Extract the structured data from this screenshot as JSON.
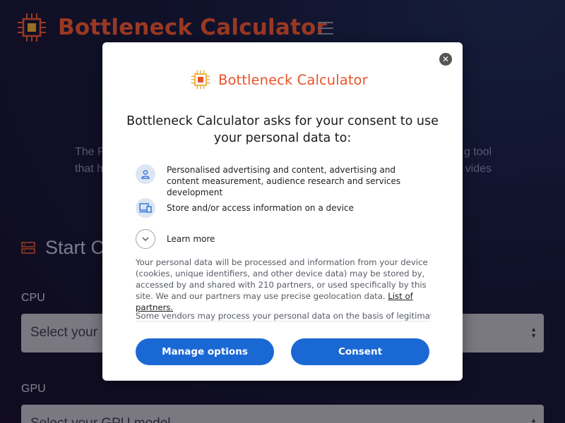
{
  "site": {
    "title": "Bottleneck Calculator",
    "accent_color": "#e8542a",
    "menu_icon": "hamburger-icon",
    "intro_line1_left": "The P",
    "intro_line1_right": "g tool",
    "intro_line2_left": "that h",
    "intro_line2_right": "vides",
    "section_title": "Start C",
    "cpu_label": "CPU",
    "cpu_select_text": "Select your",
    "gpu_label": "GPU",
    "gpu_select_text": "Select your GPU model"
  },
  "dialog": {
    "brand_text": "Bottleneck Calculator",
    "close_icon": "close-icon",
    "heading": "Bottleneck Calculator asks for your consent to use your personal data to:",
    "purposes": [
      {
        "icon": "person-icon",
        "text": "Personalised advertising and content, advertising and content measurement, audience research and services development"
      },
      {
        "icon": "device-icon",
        "text": "Store and/or access information on a device"
      }
    ],
    "learn_more": "Learn more",
    "body": "Your personal data will be processed and information from your device (cookies, unique identifiers, and other device data) may be stored by, accessed by and shared with 210 partners, or used specifically by this site. We and our partners may use precise geolocation data.",
    "partners_link": "List of partners.",
    "vendor_text": "Some vendors may process your personal data on the basis of legitimate",
    "manage_label": "Manage options",
    "consent_label": "Consent",
    "button_color": "#1a68d4"
  }
}
